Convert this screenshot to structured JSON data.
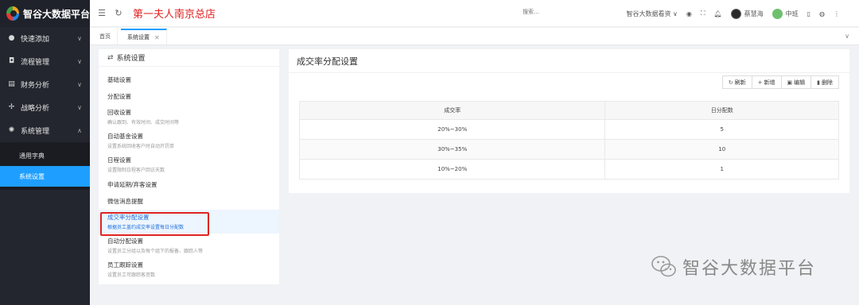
{
  "brand": {
    "name": "智谷大数据平台"
  },
  "sidebar": {
    "items": [
      {
        "label": "快速添加",
        "icon": "plus-circle-icon",
        "glyph": "●"
      },
      {
        "label": "流程管理",
        "icon": "workflow-icon",
        "glyph": "◘"
      },
      {
        "label": "财务分析",
        "icon": "finance-chart-icon",
        "glyph": "▤"
      },
      {
        "label": "战略分析",
        "icon": "strategy-icon",
        "glyph": "✢"
      },
      {
        "label": "系统管理",
        "icon": "system-gear-icon",
        "glyph": "✺"
      }
    ],
    "subitems": [
      {
        "label": "通用字典"
      },
      {
        "label": "系统设置"
      }
    ]
  },
  "header": {
    "store_title": "第一夫人南京总店",
    "search_placeholder": "搜索...",
    "platform_select": "智谷大数据看资 ∨",
    "user_name": "蔡慧海",
    "shift": "中班"
  },
  "tabs": [
    {
      "label": "首页"
    },
    {
      "label": "系统设置"
    }
  ],
  "settings": {
    "title": "系统设置",
    "items": [
      {
        "name": "基础设置",
        "desc": ""
      },
      {
        "name": "分配设置",
        "desc": ""
      },
      {
        "name": "回收设置",
        "desc": "确认跟到、有效时间、成交时间等"
      },
      {
        "name": "自动基金设置",
        "desc": "设置系统回收客户时自动开罚单"
      },
      {
        "name": "日程设置",
        "desc": "设置限制日程客户回访天数"
      },
      {
        "name": "申请延期/弃客设置",
        "desc": ""
      },
      {
        "name": "微信消息提醒",
        "desc": ""
      },
      {
        "name": "成交率分配设置",
        "desc": "根据员工盖约成交率设置每日分配数"
      },
      {
        "name": "自动分配设置",
        "desc": "设置员工分组以及每个组下的报备、跟踪人等"
      },
      {
        "name": "员工跟踪设置",
        "desc": "设置员工可跟踪客资数"
      }
    ]
  },
  "main": {
    "title": "成交率分配设置",
    "buttons": [
      {
        "label": "刷新",
        "icon": "refresh-icon",
        "glyph": "↻"
      },
      {
        "label": "新增",
        "icon": "plus-icon",
        "glyph": "+"
      },
      {
        "label": "编辑",
        "icon": "edit-icon",
        "glyph": "▣"
      },
      {
        "label": "删除",
        "icon": "trash-icon",
        "glyph": "▮"
      }
    ],
    "table": {
      "headers": [
        "成交率",
        "日分配数"
      ],
      "rows": [
        [
          "20%~30%",
          "5"
        ],
        [
          "30%~35%",
          "10"
        ],
        [
          "10%~20%",
          "1"
        ]
      ]
    }
  },
  "watermark": {
    "text": "智谷大数据平台"
  },
  "colors": {
    "accent": "#1e9fff",
    "highlight": "#e02424",
    "sidebar": "#23262e"
  }
}
